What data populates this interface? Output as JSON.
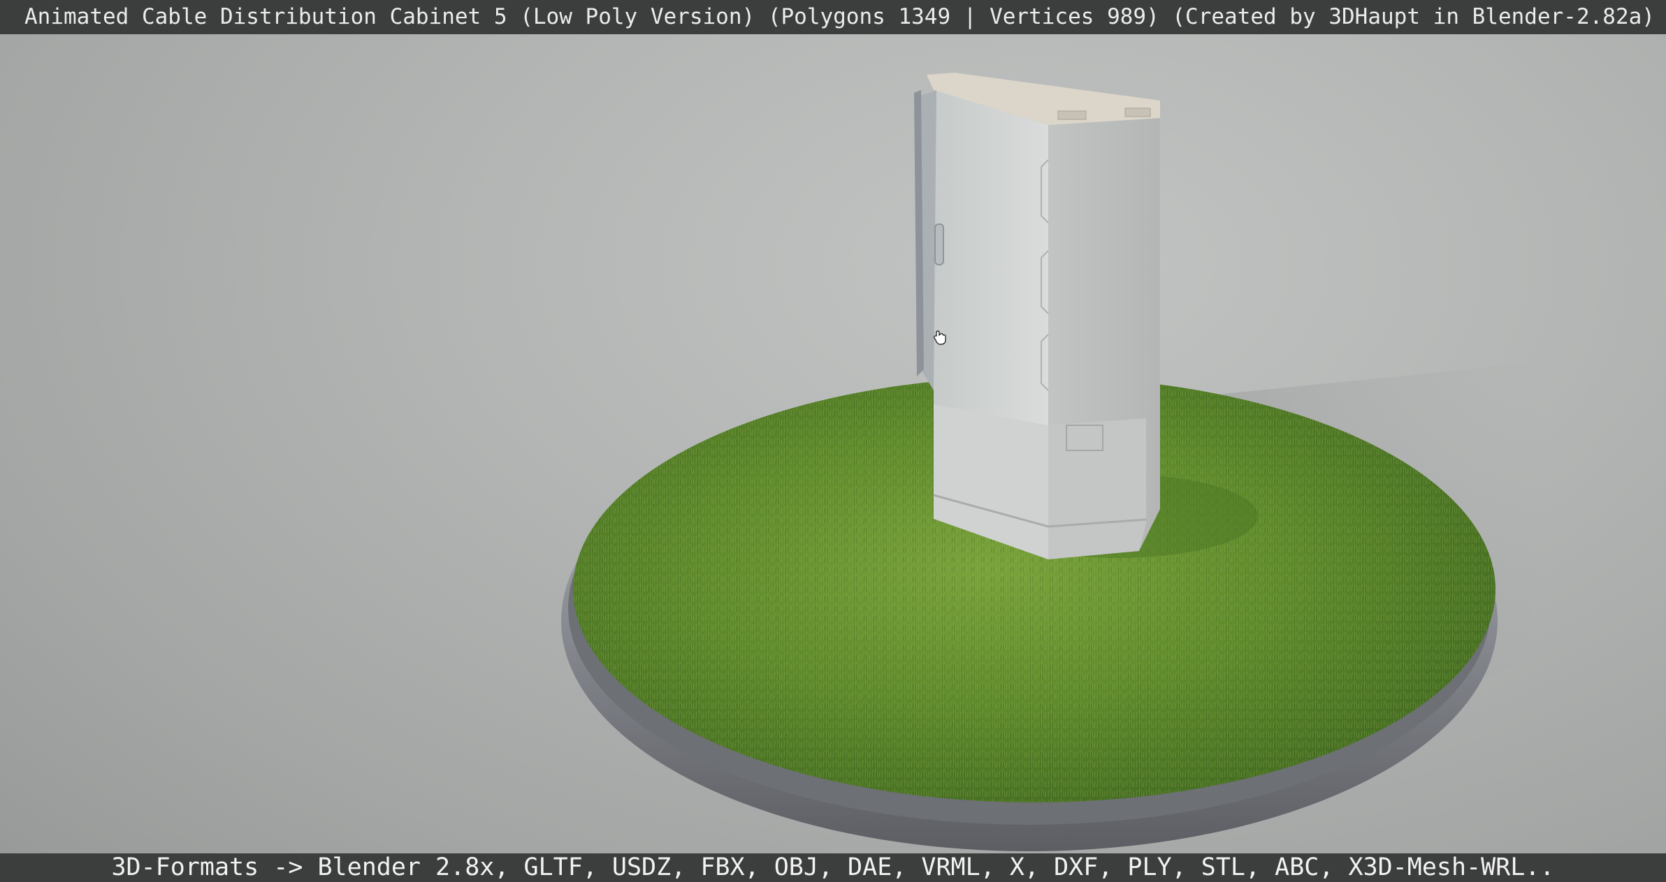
{
  "viewer": {
    "title": "Animated Cable Distribution Cabinet 5 (Low Poly Version) (Polygons 1349 | Vertices 989) (Created by 3DHaupt in Blender-2.82a)",
    "formats": "3D-Formats -> Blender 2.8x, GLTF, USDZ, FBX, OBJ, DAE, VRML, X, DXF, PLY, STL, ABC, X3D-Mesh-WRL.."
  },
  "scene": {
    "background_color": "#b3b5b4",
    "grass_color": "#5e8a2e",
    "cabinet_color": "#d6d9d8",
    "base_rim_color": "#9a9ca3"
  },
  "cursor": {
    "icon": "hand-cursor-icon"
  }
}
